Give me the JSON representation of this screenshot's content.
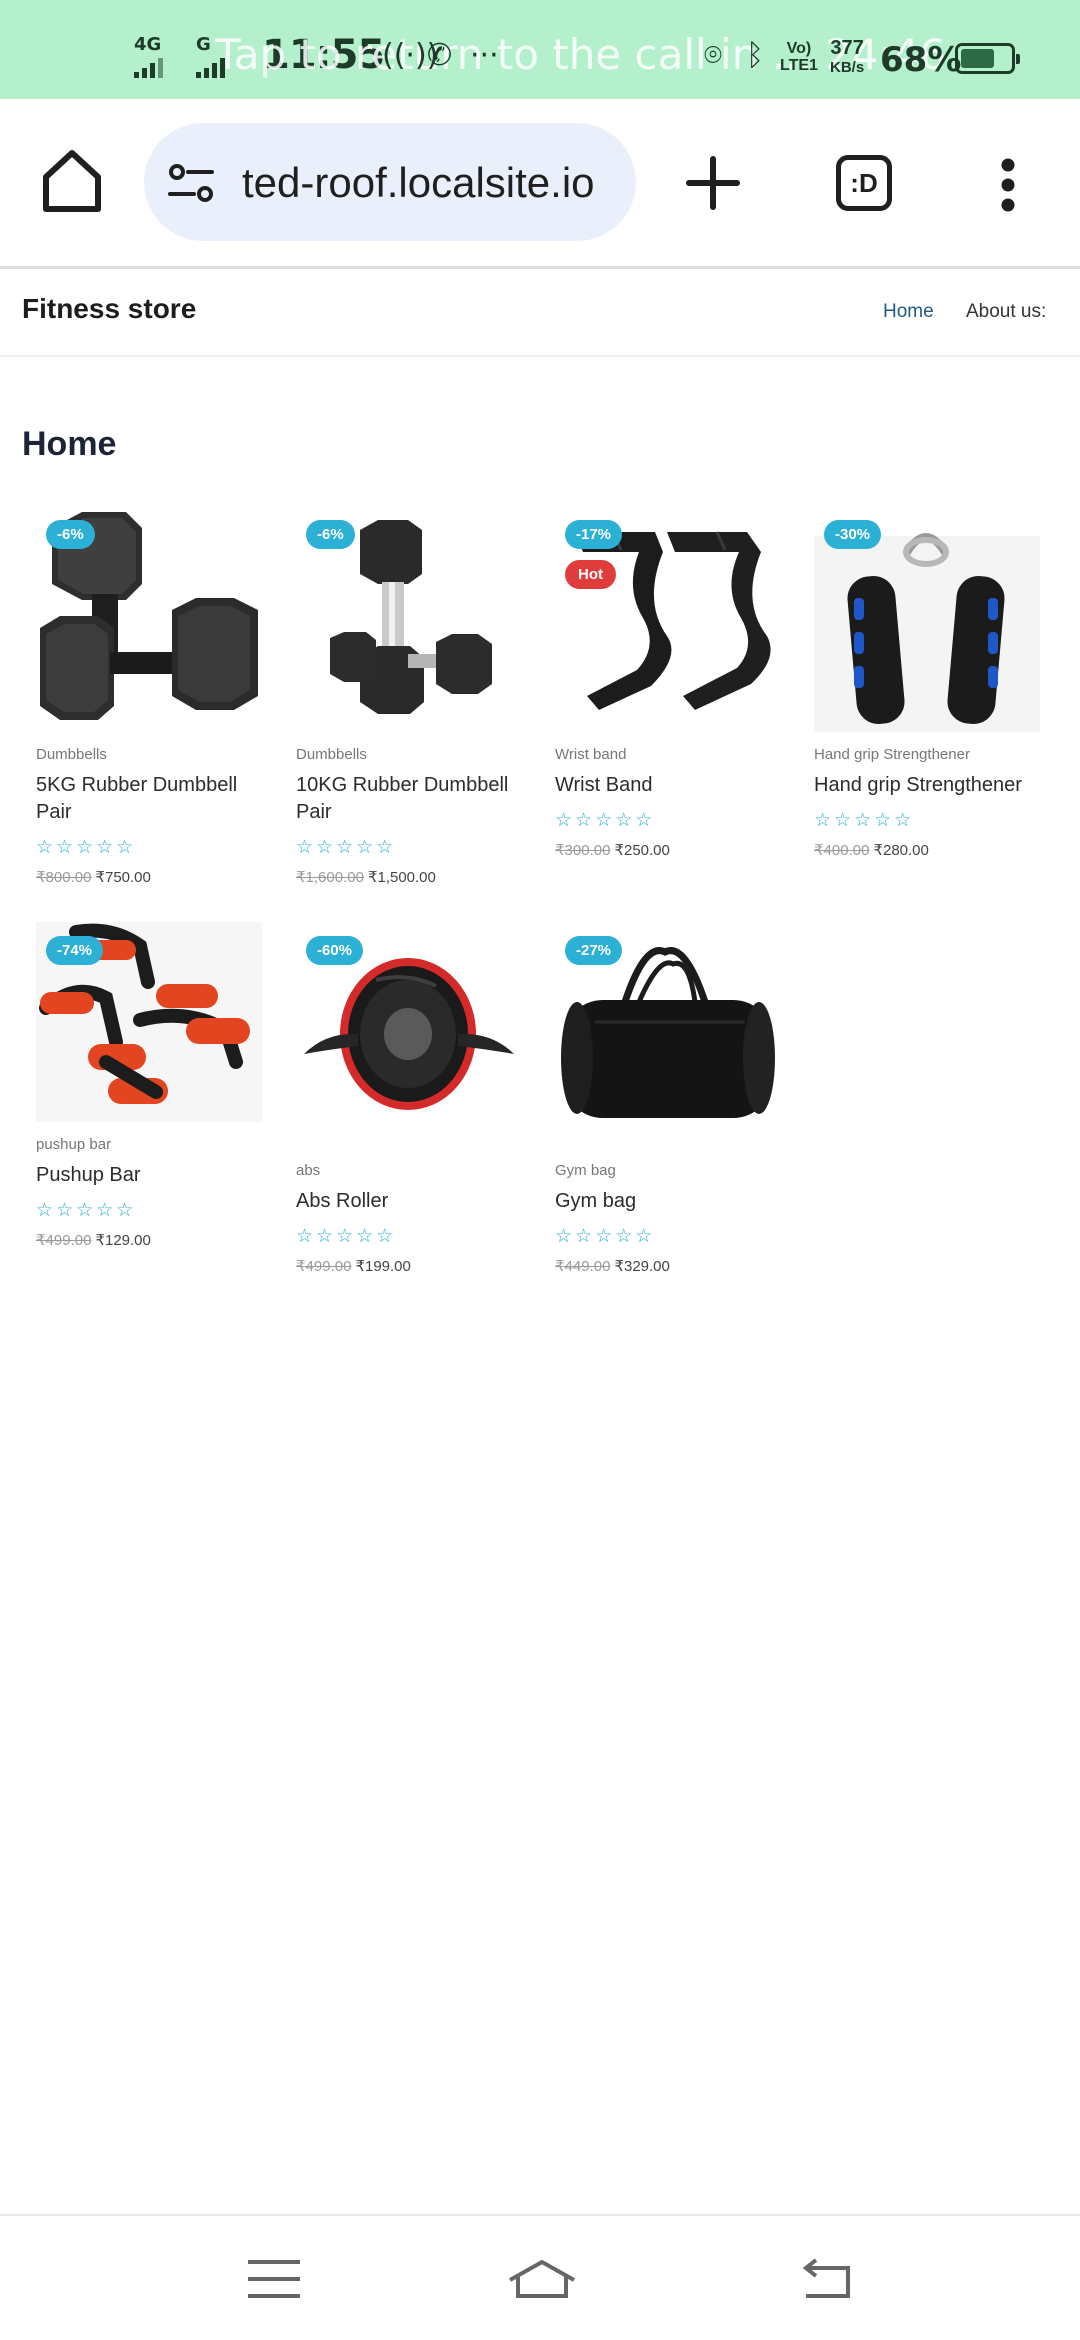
{
  "status_bar": {
    "network1": "4G",
    "network2": "G",
    "time": "11:55",
    "call_banner": "Tap to return to the call in ... 24:46",
    "volte_top": "Vo)",
    "volte_bottom": "LTE1",
    "speed_value": "377",
    "speed_unit": "KB/s",
    "battery_percent": "68%",
    "battery_level": 0.68
  },
  "browser": {
    "url": "ted-roof.localsite.io",
    "tab_icon_label": ":D",
    "icons": [
      "home-icon",
      "site-settings-icon",
      "new-tab-plus-icon",
      "tab-switcher-icon",
      "more-menu-icon"
    ]
  },
  "site": {
    "title": "Fitness store",
    "nav": {
      "home": "Home",
      "about": "About us:"
    },
    "page_title": "Home"
  },
  "products": [
    {
      "discount": "-6%",
      "hot": "",
      "category": "Dumbbells",
      "name": "5KG Rubber Dumbbell Pair",
      "old_price": "₹800.00",
      "price": "₹750.00",
      "image": "dumbbell-pair-image"
    },
    {
      "discount": "-6%",
      "hot": "",
      "category": "Dumbbells",
      "name": "10KG Rubber Dumbbell Pair",
      "old_price": "₹1,600.00",
      "price": "₹1,500.00",
      "image": "hex-dumbbell-image"
    },
    {
      "discount": "-17%",
      "hot": "Hot",
      "category": "Wrist band",
      "name": "Wrist Band",
      "old_price": "₹300.00",
      "price": "₹250.00",
      "image": "wrist-straps-image"
    },
    {
      "discount": "-30%",
      "hot": "",
      "category": "Hand grip Strengthener",
      "name": "Hand grip Strengthener",
      "old_price": "₹400.00",
      "price": "₹280.00",
      "image": "hand-grip-image"
    },
    {
      "discount": "-74%",
      "hot": "",
      "category": "pushup bar",
      "name": "Pushup Bar",
      "old_price": "₹499.00",
      "price": "₹129.00",
      "image": "pushup-bars-image"
    },
    {
      "discount": "-60%",
      "hot": "",
      "category": "abs",
      "name": "Abs Roller",
      "old_price": "₹499.00",
      "price": "₹199.00",
      "image": "abs-roller-image"
    },
    {
      "discount": "-27%",
      "hot": "",
      "category": "Gym bag",
      "name": "Gym bag",
      "old_price": "₹449.00",
      "price": "₹329.00",
      "image": "gym-bag-image"
    }
  ],
  "star_glyphs": "☆☆☆☆☆",
  "colors": {
    "accent": "#2db0d6",
    "hot": "#e03c3c",
    "status_bar": "#b5f0cd",
    "url_bar": "#eaf0fb",
    "nav_active": "#1f5a86"
  }
}
